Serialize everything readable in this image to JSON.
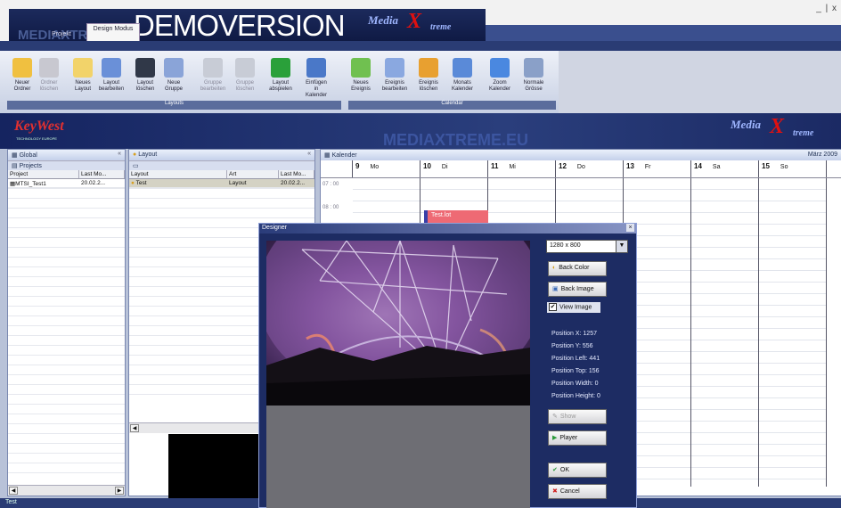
{
  "titlebar": {
    "demo_text": "DEMOVERSION",
    "ghost_text": "MEDIAXTREME",
    "logo_text": "Media",
    "logo_x": "X",
    "logo_treme": "treme",
    "window_controls": "_ | x",
    "help_icons": "◉ ◉"
  },
  "tabs": [
    {
      "label": "Projekt"
    },
    {
      "label": "Design Modus"
    }
  ],
  "ribbon": {
    "buttons": [
      {
        "label": "Neuer Ordner",
        "icon": "new-folder-icon",
        "color": "#f0c040"
      },
      {
        "label": "Ordner löschen",
        "icon": "delete-folder-icon",
        "color": "#c8c8d0",
        "disabled": true
      },
      {
        "label": "Neues Layout",
        "icon": "new-layout-icon",
        "color": "#f2d36a"
      },
      {
        "label": "Layout bearbeiten",
        "icon": "edit-layout-icon",
        "color": "#6a90d8"
      },
      {
        "label": "Layout löschen",
        "icon": "delete-layout-icon",
        "color": "#303848"
      },
      {
        "label": "Neue Gruppe",
        "icon": "new-group-icon",
        "color": "#8aa4d8"
      },
      {
        "label": "Gruppe bearbeiten",
        "icon": "edit-group-icon",
        "color": "#c8ccd6",
        "disabled": true
      },
      {
        "label": "Gruppe löschen",
        "icon": "delete-group-icon",
        "color": "#c8ccd6",
        "disabled": true
      },
      {
        "label": "Layout abspielen",
        "icon": "play-icon",
        "color": "#2aa03a"
      },
      {
        "label": "Einfügen in Kalender",
        "icon": "insert-calendar-icon",
        "color": "#4a78c8"
      },
      {
        "label": "Neues Ereignis",
        "icon": "new-event-icon",
        "color": "#70c050"
      },
      {
        "label": "Ereignis bearbeiten",
        "icon": "edit-event-icon",
        "color": "#8aa8e0"
      },
      {
        "label": "Ereignis löschen",
        "icon": "delete-event-icon",
        "color": "#e8a030"
      },
      {
        "label": "Monats Kalender",
        "icon": "month-calendar-icon",
        "color": "#5a8ad8"
      },
      {
        "label": "Zoom Kalender",
        "icon": "zoom-icon",
        "color": "#4a88e0"
      },
      {
        "label": "Normale Grösse",
        "icon": "normal-size-icon",
        "color": "#8aa0c8"
      }
    ],
    "group_layouts": "Layouts",
    "group_calendar": "Calendar"
  },
  "banner": {
    "keywest": "KeyWest",
    "keywest_sub": "TECHNOLOGY EUROPE",
    "ghost": "MEDIAXTREME.EU"
  },
  "global_panel": {
    "title": "Global",
    "subtitle": "Projects",
    "columns": [
      "Project",
      "Last Mo..."
    ],
    "rows": [
      {
        "name": "MTSI_Test1",
        "date": "20.02.2..."
      }
    ]
  },
  "layout_panel": {
    "title": "Layout",
    "columns": [
      "Layout",
      "Art",
      "Last Mo..."
    ],
    "rows": [
      {
        "name": "Test",
        "art": "Layout",
        "date": "20.02.2..."
      }
    ]
  },
  "calendar": {
    "title": "Kalender",
    "month": "März 2009",
    "days": [
      {
        "num": "9",
        "name": "Mo"
      },
      {
        "num": "10",
        "name": "Di"
      },
      {
        "num": "11",
        "name": "Mi"
      },
      {
        "num": "12",
        "name": "Do"
      },
      {
        "num": "13",
        "name": "Fr"
      },
      {
        "num": "14",
        "name": "Sa"
      },
      {
        "num": "15",
        "name": "So"
      }
    ],
    "times": [
      "07 : 00",
      "08 : 00"
    ],
    "event": "Test.lot"
  },
  "designer": {
    "title": "Designer",
    "resolution": "1280 x 800",
    "back_color": "Back Color",
    "back_image": "Back Image",
    "view_image": "View Image",
    "view_image_checked": "✔",
    "positions": [
      "Position X: 1257",
      "Position Y: 556",
      "Position Left: 441",
      "Position Top: 156",
      "Position Width: 0",
      "Position Height: 0"
    ],
    "show": "Show",
    "player": "Player",
    "ok": "OK",
    "cancel": "Cancel"
  },
  "status": {
    "text": "Test"
  }
}
